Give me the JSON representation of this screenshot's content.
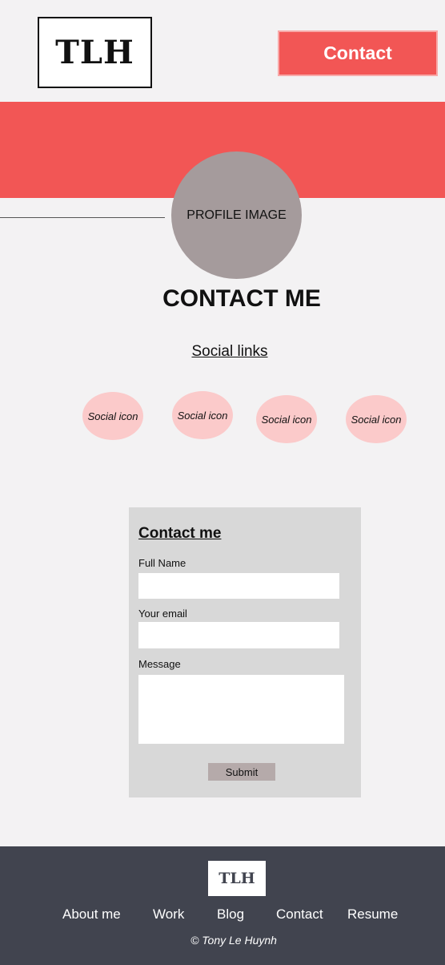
{
  "header": {
    "logo_text": "TLH",
    "contact_label": "Contact"
  },
  "profile": {
    "placeholder": "PROFILE IMAGE"
  },
  "page_title": "CONTACT ME",
  "social": {
    "heading": "Social links",
    "icons": [
      "Social icon",
      "Social icon",
      "Social icon",
      "Social icon"
    ]
  },
  "form": {
    "title": "Contact me",
    "full_name_label": "Full Name",
    "full_name_value": "",
    "email_label": "Your email",
    "email_value": "",
    "message_label": "Message",
    "message_value": "",
    "submit_label": "Submit"
  },
  "footer": {
    "logo_text": "TLH",
    "nav": [
      "About me",
      "Work",
      "Blog",
      "Contact",
      "Resume"
    ],
    "copyright": "© Tony Le Huynh"
  },
  "colors": {
    "accent": "#f25655",
    "page_bg": "#f3f2f3",
    "footer_bg": "#41444f",
    "social_icon_bg": "#fbcaca",
    "profile_bg": "#a59b9c",
    "form_bg": "#d8d8d8"
  }
}
